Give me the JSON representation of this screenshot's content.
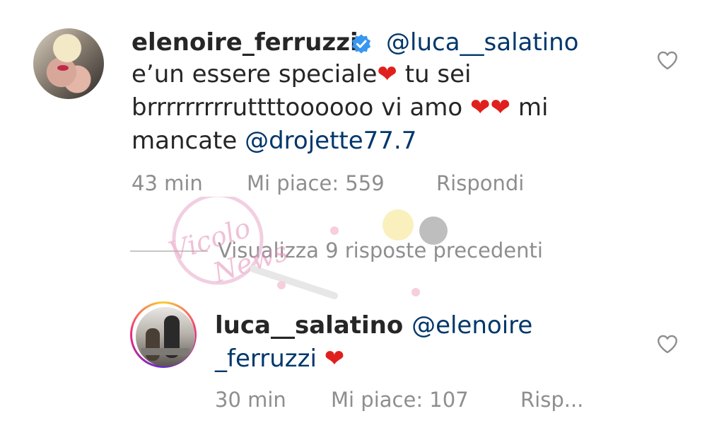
{
  "comment": {
    "username": "elenoire_ferruzzi",
    "mention": "@luca__salatino",
    "line1": "e’un essere speciale",
    "line1_after": " tu sei",
    "line2": "brrrrrrrrruttttoooooo vi amo ",
    "line2_after": " mi",
    "line3": "mancate ",
    "line3_mention": "@drojette77.7",
    "heart": "❤",
    "time": "43 min",
    "likes": "Mi piace: 559",
    "reply": "Rispondi"
  },
  "view_replies": "Visualizza 9 risposte precedenti",
  "reply_comment": {
    "username": "luca__salatino",
    "mention_line1": "@elenoire",
    "mention_line2": "_ferruzzi",
    "heart": "❤",
    "time": "30 min",
    "likes": "Mi piace: 107",
    "reply": "Risp..."
  },
  "watermark_text": "Vicolo News",
  "colors": {
    "text": "#262626",
    "mention": "#00376b",
    "meta": "#8e8e8e",
    "heart": "#e0201d",
    "verified": "#3897f0"
  },
  "icons": [
    "verified-badge-icon",
    "heart-outline-icon",
    "heart-emoji-icon"
  ]
}
